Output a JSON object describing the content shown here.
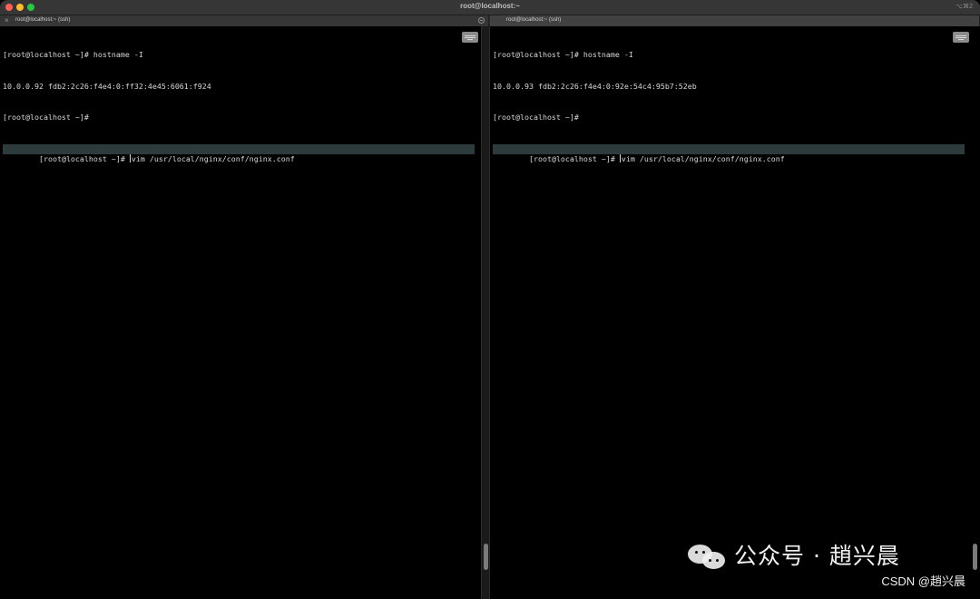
{
  "window": {
    "title": "root@localhost:~",
    "shortcut": "⌥⌘2"
  },
  "tabs": {
    "left": {
      "title": "root@localhost:~ (ssh)"
    },
    "right": {
      "title": "root@localhost:~ (ssh)"
    }
  },
  "panes": {
    "left": {
      "lines": [
        "[root@localhost ~]# hostname -I",
        "10.0.0.92 fdb2:2c26:f4e4:0:ff32:4e45:6061:f924",
        "[root@localhost ~]#",
        "[root@localhost ~]# vim /usr/local/nginx/conf/nginx.conf"
      ],
      "active_prompt": "[root@localhost ~]# ",
      "active_command": "vim /usr/local/nginx/conf/nginx.conf"
    },
    "right": {
      "lines": [
        "[root@localhost ~]# hostname -I",
        "10.0.0.93 fdb2:2c26:f4e4:0:92e:54c4:95b7:52eb",
        "[root@localhost ~]#",
        "[root@localhost ~]# vim /usr/local/nginx/conf/nginx.conf"
      ],
      "active_prompt": "[root@localhost ~]# ",
      "active_command": "vim /usr/local/nginx/conf/nginx.conf"
    }
  },
  "watermark": {
    "main": "公众号 · 趙兴晨",
    "sub": "CSDN @趙兴晨"
  },
  "icons": {
    "traffic_close": "close-window-icon",
    "traffic_minimize": "minimize-window-icon",
    "traffic_maximize": "maximize-window-icon",
    "tab_close": "close-tab-icon",
    "tab_menu": "tab-options-icon",
    "keyboard": "keyboard-icon",
    "wechat": "wechat-icon"
  },
  "colors": {
    "terminal_background": "#000000",
    "terminal_text": "#d8d8d8",
    "active_line": "#2e3b3d",
    "titlebar": "#363636"
  }
}
